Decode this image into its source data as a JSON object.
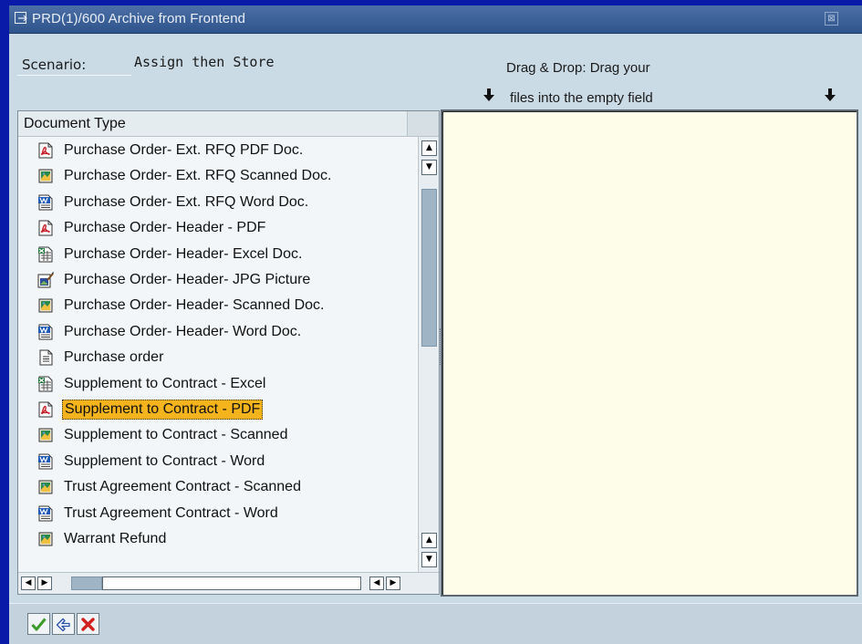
{
  "window": {
    "title": "PRD(1)/600 Archive from Frontend",
    "close_glyph": "⊠"
  },
  "scenario": {
    "label": "Scenario:",
    "value": "Assign then Store"
  },
  "drag_drop": {
    "line1": "Drag & Drop: Drag your",
    "line2": "files into the empty field"
  },
  "list": {
    "header": "Document Type",
    "items": [
      {
        "label": "Purchase Order- Ext. RFQ PDF Doc.",
        "icon": "pdf-icon"
      },
      {
        "label": "Purchase Order- Ext. RFQ Scanned Doc.",
        "icon": "scanned-image-icon"
      },
      {
        "label": "Purchase Order- Ext. RFQ Word Doc.",
        "icon": "word-doc-icon"
      },
      {
        "label": "Purchase Order- Header - PDF",
        "icon": "pdf-icon"
      },
      {
        "label": "Purchase Order- Header- Excel Doc.",
        "icon": "excel-doc-icon"
      },
      {
        "label": "Purchase Order- Header- JPG Picture",
        "icon": "jpg-picture-icon"
      },
      {
        "label": "Purchase Order- Header- Scanned Doc.",
        "icon": "scanned-image-icon"
      },
      {
        "label": "Purchase Order- Header- Word Doc.",
        "icon": "word-doc-icon"
      },
      {
        "label": "Purchase order",
        "icon": "document-icon"
      },
      {
        "label": "Supplement to Contract - Excel",
        "icon": "excel-doc-icon"
      },
      {
        "label": "Supplement to Contract - PDF",
        "icon": "pdf-icon",
        "selected": true
      },
      {
        "label": "Supplement to Contract - Scanned",
        "icon": "scanned-image-icon"
      },
      {
        "label": "Supplement to Contract - Word",
        "icon": "word-doc-icon"
      },
      {
        "label": "Trust Agreement Contract - Scanned",
        "icon": "scanned-image-icon"
      },
      {
        "label": "Trust Agreement Contract - Word",
        "icon": "word-doc-icon"
      },
      {
        "label": "Warrant Refund",
        "icon": "scanned-image-icon"
      }
    ]
  },
  "toolbar": {
    "buttons": [
      {
        "name": "confirm-button",
        "icon": "checkmark-icon"
      },
      {
        "name": "continue-button",
        "icon": "continue-hand-icon"
      },
      {
        "name": "cancel-button",
        "icon": "cancel-x-icon"
      }
    ]
  },
  "colors": {
    "background": "#0a1aa8",
    "window": "#cbdbe5",
    "titlebar": "#3a5e95",
    "selection": "#f5b31c",
    "drop_field": "#fefde9"
  }
}
